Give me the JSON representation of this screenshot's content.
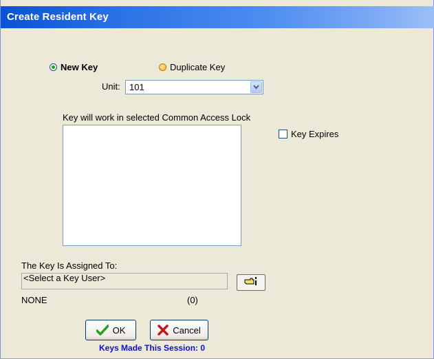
{
  "window": {
    "title": "Create Resident Key"
  },
  "key_type": {
    "new_key_label": "New Key",
    "duplicate_key_label": "Duplicate Key",
    "selected": "new_key"
  },
  "unit": {
    "label": "Unit:",
    "value": "101"
  },
  "common_access": {
    "label": "Key will work in selected Common Access Lock",
    "items": []
  },
  "key_expires": {
    "label": "Key Expires",
    "checked": false
  },
  "assignment": {
    "label": "The Key Is Assigned To:",
    "value": "<Select a Key User>",
    "user_name": "NONE",
    "user_count": "(0)",
    "picker_icon": "hand-pointer-icon"
  },
  "actions": {
    "ok_label": "OK",
    "cancel_label": "Cancel",
    "ok_icon": "checkmark-icon",
    "cancel_icon": "x-icon"
  },
  "session": {
    "text": "Keys Made This Session: 0"
  },
  "colors": {
    "title_bar": "#0a52d6",
    "dialog_bg": "#ece9d8",
    "session_text": "#1010c8",
    "ok_check": "#21a121",
    "cancel_x": "#c01818"
  }
}
